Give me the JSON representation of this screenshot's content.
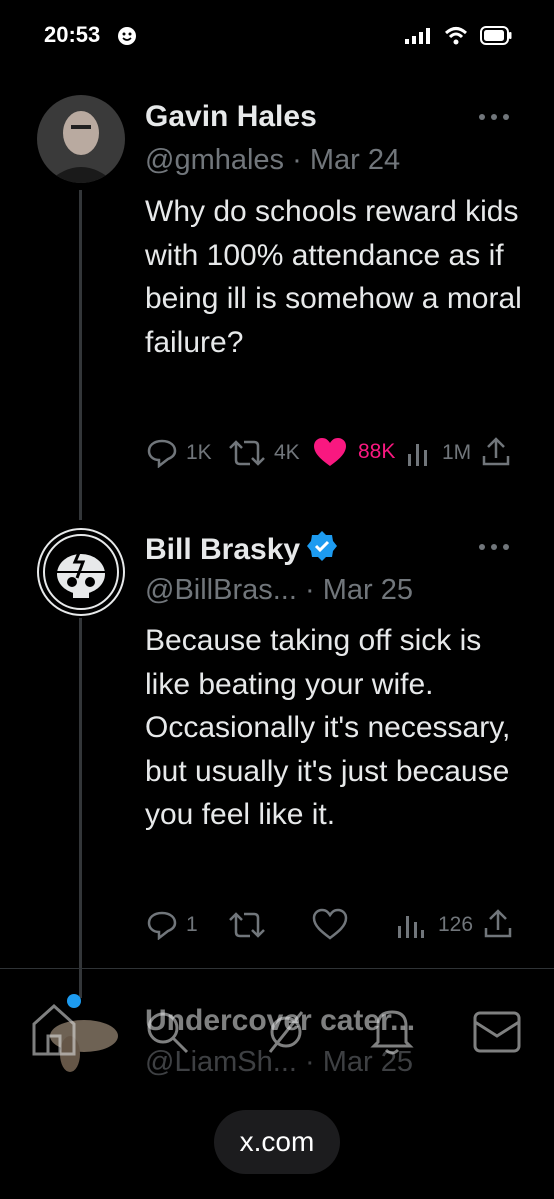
{
  "status_bar": {
    "time": "20:53"
  },
  "tweets": [
    {
      "name": "Gavin Hales",
      "handle": "@gmhales",
      "date": "Mar 24",
      "text": "Why do schools reward kids with 100% attendance as if being ill is somehow a moral failure?",
      "replies": "1K",
      "reposts": "4K",
      "likes": "88K",
      "views": "1M",
      "liked": true
    },
    {
      "name": "Bill Brasky",
      "handle": "@BillBras...",
      "date": "Mar 25",
      "verified": true,
      "text": "Because taking off sick is like beating your wife. Occasionally it's necessary, but usually it's just because you feel like it.",
      "replies": "1",
      "reposts": "",
      "likes": "",
      "views": "126"
    },
    {
      "name": "Undercover cater...",
      "handle": "@LiamSh...",
      "date": "Mar 25"
    }
  ],
  "browser": {
    "url": "x.com"
  },
  "colors": {
    "accent": "#1d9bf0",
    "like": "#f91880",
    "muted": "#71767b",
    "text": "#e7e9ea"
  },
  "icons": [
    "smiley-icon",
    "signal-icon",
    "wifi-icon",
    "battery-icon",
    "more-icon",
    "reply-icon",
    "repost-icon",
    "like-icon",
    "views-icon",
    "share-icon",
    "verified-icon",
    "home-icon",
    "search-icon",
    "notifications-icon",
    "messages-icon"
  ]
}
